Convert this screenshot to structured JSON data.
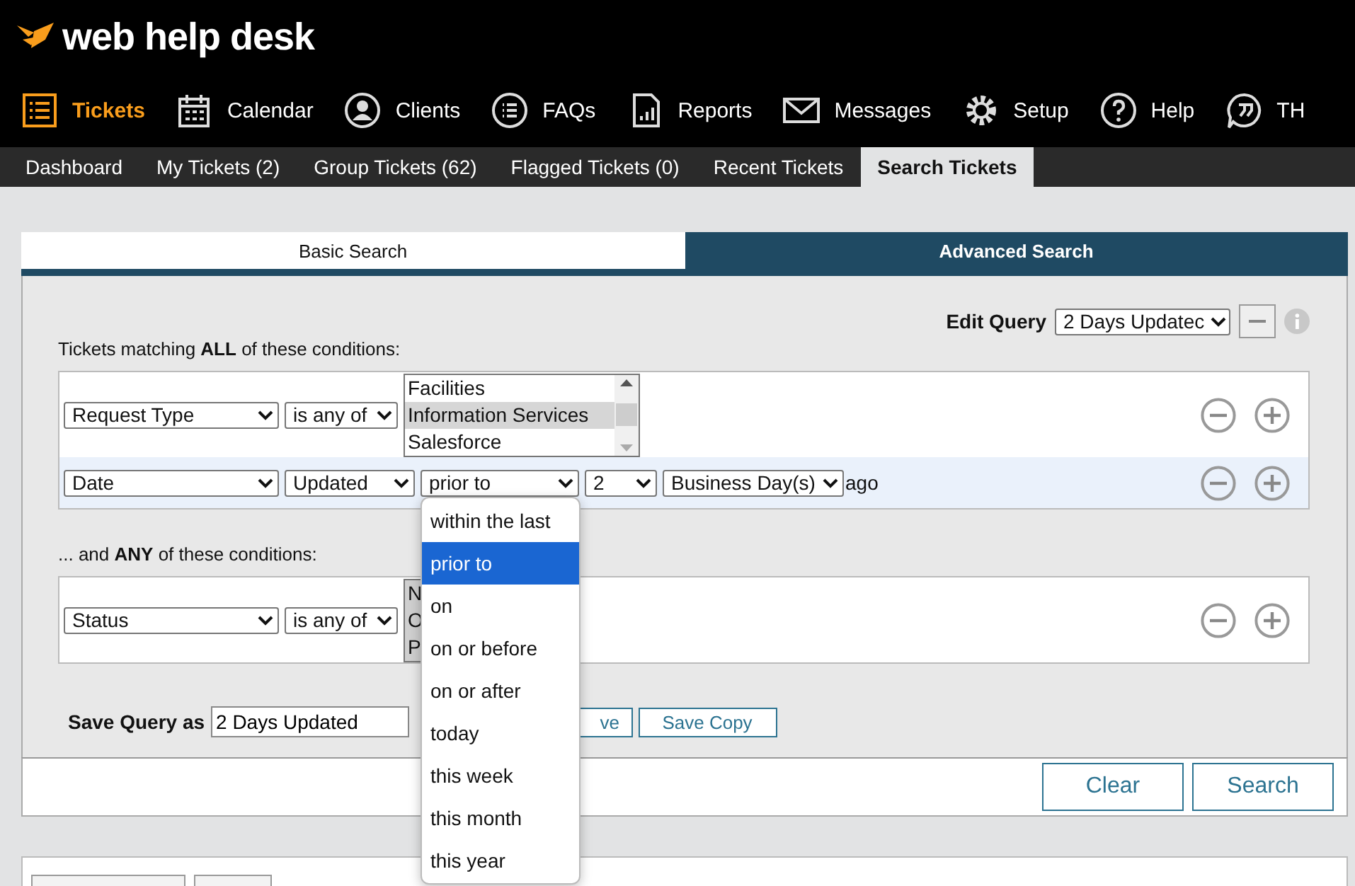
{
  "logo": {
    "text": "web help desk"
  },
  "nav": [
    {
      "label": "Tickets",
      "selected": true
    },
    {
      "label": "Calendar",
      "selected": false
    },
    {
      "label": "Clients",
      "selected": false
    },
    {
      "label": "FAQs",
      "selected": false
    },
    {
      "label": "Reports",
      "selected": false
    },
    {
      "label": "Messages",
      "selected": false
    },
    {
      "label": "Setup",
      "selected": false
    },
    {
      "label": "Help",
      "selected": false
    },
    {
      "label": "TH",
      "selected": false
    }
  ],
  "subnav": [
    {
      "label": "Dashboard",
      "selected": false
    },
    {
      "label": "My Tickets (2)",
      "selected": false
    },
    {
      "label": "Group Tickets (62)",
      "selected": false
    },
    {
      "label": "Flagged Tickets (0)",
      "selected": false
    },
    {
      "label": "Recent Tickets",
      "selected": false
    },
    {
      "label": "Search Tickets",
      "selected": true
    }
  ],
  "search_tabs": [
    {
      "label": "Basic Search",
      "selected": false
    },
    {
      "label": "Advanced Search",
      "selected": true
    }
  ],
  "edit_query": {
    "label": "Edit Query",
    "value": "2 Days Updatec"
  },
  "all_heading": "Tickets matching **ALL** of these conditions:",
  "all_conditions": [
    {
      "kind": "list",
      "field": "Request Type",
      "operator": "is any of",
      "options": [
        {
          "label": "Facilities",
          "selected": false
        },
        {
          "label": "Information Services",
          "selected": true
        },
        {
          "label": "Salesforce",
          "selected": false
        }
      ]
    },
    {
      "kind": "date",
      "field": "Date",
      "attribute": "Updated",
      "operator": "prior to",
      "amount": "2",
      "unit": "Business Day(s)",
      "suffix": "ago",
      "highlighted": true
    }
  ],
  "any_heading": "... and **ANY** of these conditions:",
  "any_conditions": [
    {
      "kind": "list",
      "field": "Status",
      "operator": "is any of",
      "options": [
        {
          "label": "N"
        },
        {
          "label": "O"
        },
        {
          "label": "P"
        }
      ]
    }
  ],
  "save_query": {
    "label": "Save Query as",
    "value": "2 Days Updated",
    "buttons": [
      "ve",
      "Save Copy"
    ]
  },
  "footer_buttons": [
    "Clear",
    "Search"
  ],
  "dropdown": {
    "options": [
      {
        "label": "within the last",
        "selected": false
      },
      {
        "label": "prior to",
        "selected": true
      },
      {
        "label": "on",
        "selected": false
      },
      {
        "label": "on or before",
        "selected": false
      },
      {
        "label": "on or after",
        "selected": false
      },
      {
        "label": "today",
        "selected": false
      },
      {
        "label": "this week",
        "selected": false
      },
      {
        "label": "this month",
        "selected": false
      },
      {
        "label": "this year",
        "selected": false
      }
    ]
  }
}
